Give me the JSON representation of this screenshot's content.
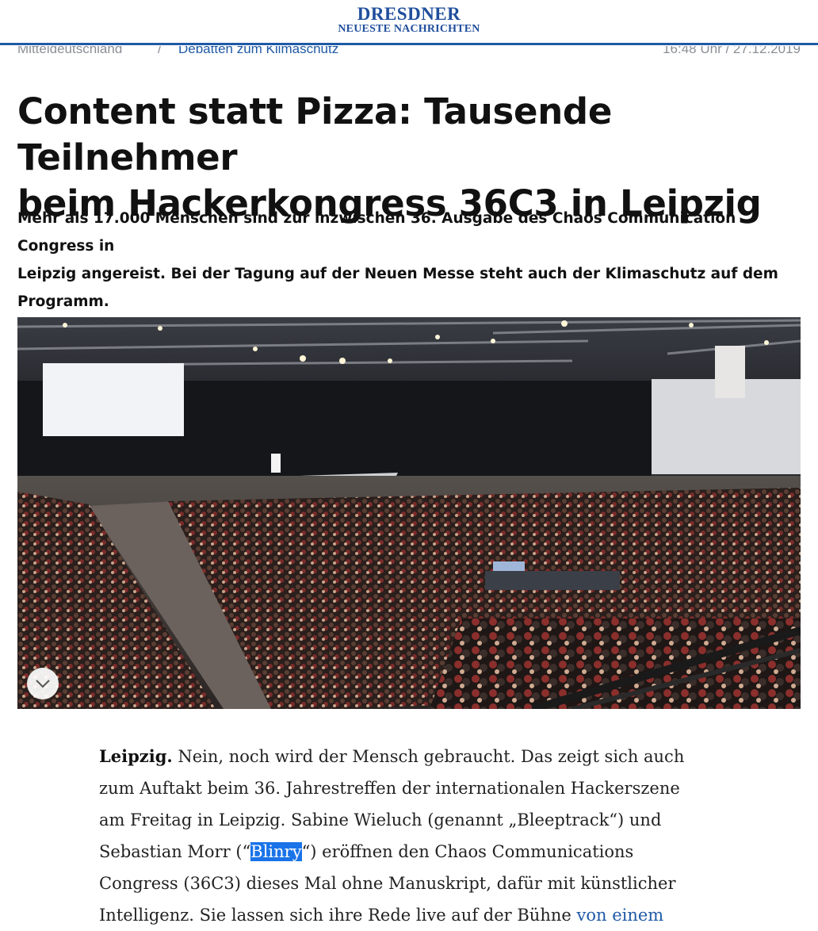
{
  "header": {
    "logo_line1": "DRESDNER",
    "logo_line2": "NEUESTE NACHRICHTEN",
    "brand_color": "#1f5aa6"
  },
  "breadcrumb": {
    "section": "Mitteldeutschland",
    "separator": "/",
    "topic": "Debatten zum Klimaschutz",
    "timestamp": "16:48 Uhr / 27.12.2019"
  },
  "article": {
    "headline_line1": "Content statt Pizza: Tausende Teilnehmer",
    "headline_line2": "beim Hackerkongress 36C3 in Leipzig",
    "teaser_line1": "Mehr als 17.000 Menschen sind zur inzwischen 36. Ausgabe des Chaos Communication Congress in",
    "teaser_line2": "Leipzig angereist. Bei der Tagung auf der Neuen Messe steht auch der Klimaschutz auf dem",
    "teaser_line3": "Programm.",
    "image_icon": "chevron-down-icon",
    "body": {
      "dateline": "Leipzig.",
      "line1_rest": " Nein, noch wird der Mensch gebraucht. Das zeigt sich auch",
      "line2": "zum Auftakt beim 36. Jahrestreffen der internationalen Hackerszene",
      "line3": "am Freitag in Leipzig. Sabine Wieluch (genannt „Bleeptrack“) und",
      "line4_pre": "Sebastian Morr (“",
      "line4_selected": "Blinry",
      "line4_post": "“) eröffnen den Chaos Communications",
      "line5": "Congress (36C3) dieses Mal ohne Manuskript, dafür mit künstlicher",
      "line6_pre": "Intelligenz. Sie lassen sich ihre Rede live auf der Bühne ",
      "line6_link": "von einem"
    }
  }
}
